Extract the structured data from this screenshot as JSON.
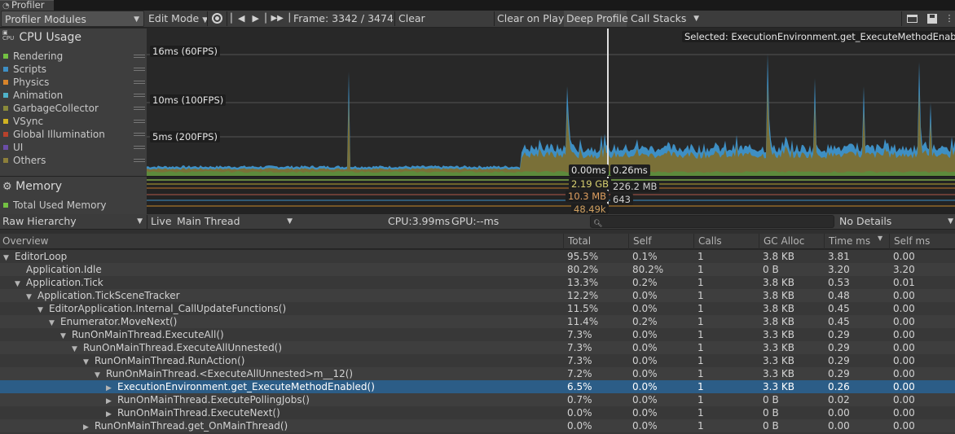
{
  "window": {
    "tab_title": "Profiler",
    "tab_icon": "profiler-icon"
  },
  "toolbar": {
    "modules_label": "Profiler Modules",
    "edit_mode_label": "Edit Mode",
    "frame_label": "Frame: 3342 / 3474",
    "clear_label": "Clear",
    "clear_on_play_label": "Clear on Play",
    "deep_profile_label": "Deep Profile",
    "call_stacks_label": "Call Stacks",
    "icons": [
      "record-icon",
      "step-back-icon",
      "step-forward-icon",
      "jump-to-end-icon",
      "load-icon",
      "save-icon",
      "menu-icon"
    ]
  },
  "cpu_module": {
    "title": "CPU Usage",
    "legend": [
      {
        "name": "Rendering",
        "color": "#73c143"
      },
      {
        "name": "Scripts",
        "color": "#3e8fc4"
      },
      {
        "name": "Physics",
        "color": "#d8842b"
      },
      {
        "name": "Animation",
        "color": "#4fb2c9"
      },
      {
        "name": "GarbageCollector",
        "color": "#8a8a3a"
      },
      {
        "name": "VSync",
        "color": "#d0b322"
      },
      {
        "name": "Global Illumination",
        "color": "#b8422c"
      },
      {
        "name": "UI",
        "color": "#6b4ea8"
      },
      {
        "name": "Others",
        "color": "#8c7f3a"
      }
    ],
    "ref_lines": [
      "16ms (60FPS)",
      "10ms (100FPS)",
      "5ms (200FPS)"
    ],
    "selected_label": "Selected: ExecutionEnvironment.get_ExecuteMethodEnabled()",
    "cursor_values": [
      "0.00ms",
      "0.26ms"
    ]
  },
  "memory_module": {
    "title": "Memory",
    "legend": [
      {
        "name": "Total Used Memory",
        "color": "#73c143"
      }
    ],
    "cursor_values": [
      "2.19 GB",
      "226.2 MB",
      "10.3 MB",
      "643",
      "48.49k"
    ]
  },
  "hierarchy_toolbar": {
    "view_label": "Raw Hierarchy",
    "live_label": "Live",
    "thread_label": "Main Thread",
    "cpu_label": "CPU:3.99ms",
    "gpu_label": "GPU:--ms",
    "search_placeholder": "",
    "details_label": "No Details"
  },
  "table": {
    "columns": [
      "Overview",
      "Total",
      "Self",
      "Calls",
      "GC Alloc",
      "Time ms",
      "Self ms"
    ],
    "sorted_column": "Time ms",
    "rows": [
      {
        "depth": 0,
        "expander": "open",
        "name": "EditorLoop",
        "total": "95.5%",
        "self": "0.1%",
        "calls": "1",
        "gc": "3.8 KB",
        "time": "3.81",
        "selfms": "0.00"
      },
      {
        "depth": 1,
        "expander": "none",
        "name": "Application.Idle",
        "total": "80.2%",
        "self": "80.2%",
        "calls": "1",
        "gc": "0 B",
        "time": "3.20",
        "selfms": "3.20"
      },
      {
        "depth": 1,
        "expander": "open",
        "name": "Application.Tick",
        "total": "13.3%",
        "self": "0.2%",
        "calls": "1",
        "gc": "3.8 KB",
        "time": "0.53",
        "selfms": "0.01"
      },
      {
        "depth": 2,
        "expander": "open",
        "name": "Application.TickSceneTracker",
        "total": "12.2%",
        "self": "0.0%",
        "calls": "1",
        "gc": "3.8 KB",
        "time": "0.48",
        "selfms": "0.00"
      },
      {
        "depth": 3,
        "expander": "open",
        "name": "EditorApplication.Internal_CallUpdateFunctions()",
        "total": "11.5%",
        "self": "0.0%",
        "calls": "1",
        "gc": "3.8 KB",
        "time": "0.45",
        "selfms": "0.00"
      },
      {
        "depth": 4,
        "expander": "open",
        "name": "Enumerator.MoveNext()",
        "total": "11.4%",
        "self": "0.2%",
        "calls": "1",
        "gc": "3.8 KB",
        "time": "0.45",
        "selfms": "0.00"
      },
      {
        "depth": 5,
        "expander": "open",
        "name": "RunOnMainThread.ExecuteAll()",
        "total": "7.3%",
        "self": "0.0%",
        "calls": "1",
        "gc": "3.3 KB",
        "time": "0.29",
        "selfms": "0.00"
      },
      {
        "depth": 6,
        "expander": "open",
        "name": "RunOnMainThread.ExecuteAllUnnested()",
        "total": "7.3%",
        "self": "0.0%",
        "calls": "1",
        "gc": "3.3 KB",
        "time": "0.29",
        "selfms": "0.00"
      },
      {
        "depth": 7,
        "expander": "open",
        "name": "RunOnMainThread.RunAction()",
        "total": "7.3%",
        "self": "0.0%",
        "calls": "1",
        "gc": "3.3 KB",
        "time": "0.29",
        "selfms": "0.00"
      },
      {
        "depth": 8,
        "expander": "open",
        "name": "RunOnMainThread.<ExecuteAllUnnested>m__12()",
        "total": "7.2%",
        "self": "0.0%",
        "calls": "1",
        "gc": "3.3 KB",
        "time": "0.29",
        "selfms": "0.00"
      },
      {
        "depth": 9,
        "expander": "closed",
        "name": "ExecutionEnvironment.get_ExecuteMethodEnabled()",
        "total": "6.5%",
        "self": "0.0%",
        "calls": "1",
        "gc": "3.3 KB",
        "time": "0.26",
        "selfms": "0.00",
        "selected": true
      },
      {
        "depth": 9,
        "expander": "closed",
        "name": "RunOnMainThread.ExecutePollingJobs()",
        "total": "0.7%",
        "self": "0.0%",
        "calls": "1",
        "gc": "0 B",
        "time": "0.02",
        "selfms": "0.00"
      },
      {
        "depth": 9,
        "expander": "closed",
        "name": "RunOnMainThread.ExecuteNext()",
        "total": "0.0%",
        "self": "0.0%",
        "calls": "1",
        "gc": "0 B",
        "time": "0.00",
        "selfms": "0.00"
      },
      {
        "depth": 7,
        "expander": "closed",
        "name": "RunOnMainThread.get_OnMainThread()",
        "total": "0.0%",
        "self": "0.0%",
        "calls": "1",
        "gc": "0 B",
        "time": "0.00",
        "selfms": "0.00"
      }
    ]
  }
}
